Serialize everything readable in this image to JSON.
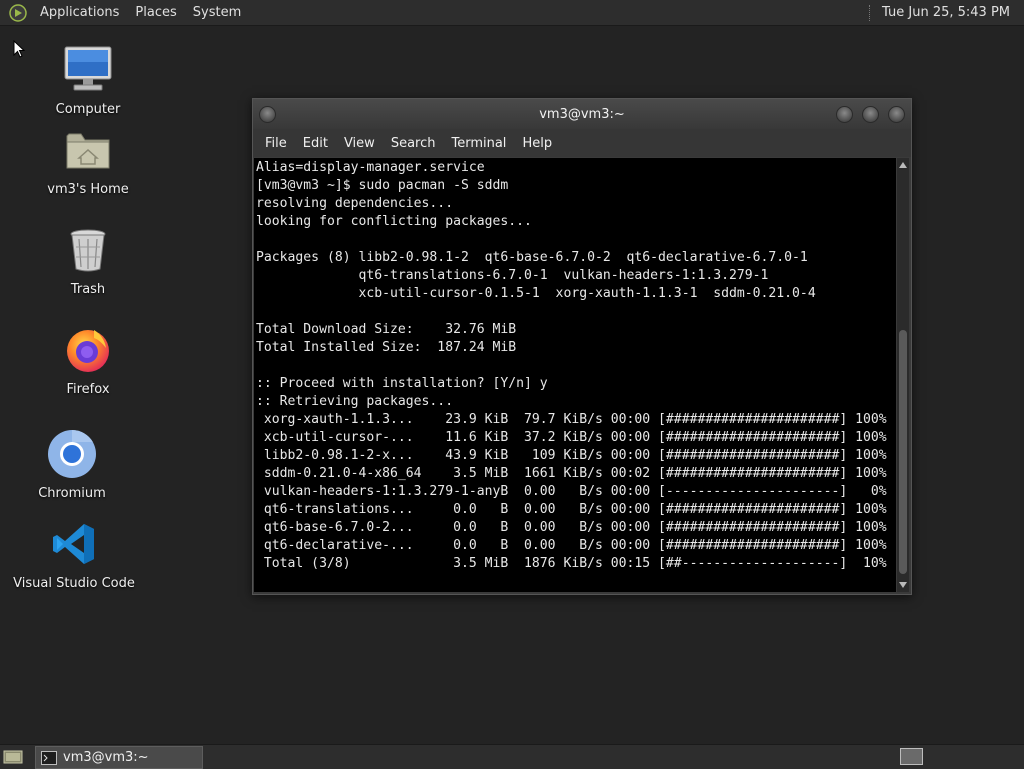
{
  "top_panel": {
    "menus": [
      "Applications",
      "Places",
      "System"
    ],
    "clock": "Tue Jun 25,  5:43 PM"
  },
  "desktop_icons": [
    {
      "label": "Computer",
      "icon": "computer-icon"
    },
    {
      "label": "vm3's Home",
      "icon": "home-folder-icon"
    },
    {
      "label": "Trash",
      "icon": "trash-icon"
    },
    {
      "label": "Firefox",
      "icon": "firefox-icon"
    },
    {
      "label": "Chromium",
      "icon": "chromium-icon"
    },
    {
      "label": "Visual Studio Code",
      "icon": "vscode-icon"
    }
  ],
  "window": {
    "title": "vm3@vm3:~",
    "menu": [
      "File",
      "Edit",
      "View",
      "Search",
      "Terminal",
      "Help"
    ],
    "terminal_output": "Alias=display-manager.service\n[vm3@vm3 ~]$ sudo pacman -S sddm\nresolving dependencies...\nlooking for conflicting packages...\n\nPackages (8) libb2-0.98.1-2  qt6-base-6.7.0-2  qt6-declarative-6.7.0-1\n             qt6-translations-6.7.0-1  vulkan-headers-1:1.3.279-1\n             xcb-util-cursor-0.1.5-1  xorg-xauth-1.1.3-1  sddm-0.21.0-4\n\nTotal Download Size:    32.76 MiB\nTotal Installed Size:  187.24 MiB\n\n:: Proceed with installation? [Y/n] y\n:: Retrieving packages...\n xorg-xauth-1.1.3...    23.9 KiB  79.7 KiB/s 00:00 [######################] 100%\n xcb-util-cursor-...    11.6 KiB  37.2 KiB/s 00:00 [######################] 100%\n libb2-0.98.1-2-x...    43.9 KiB   109 KiB/s 00:00 [######################] 100%\n sddm-0.21.0-4-x86_64    3.5 MiB  1661 KiB/s 00:02 [######################] 100%\n vulkan-headers-1:1.3.279-1-anyB  0.00   B/s 00:00 [----------------------]   0%\n qt6-translations...     0.0   B  0.00   B/s 00:00 [######################] 100%\n qt6-base-6.7.0-2...     0.0   B  0.00   B/s 00:00 [######################] 100%\n qt6-declarative-...     0.0   B  0.00   B/s 00:00 [######################] 100%\n Total (3/8)             3.5 MiB  1876 KiB/s 00:15 [##--------------------]  10%"
  },
  "taskbar": {
    "task_label": "vm3@vm3:~"
  }
}
